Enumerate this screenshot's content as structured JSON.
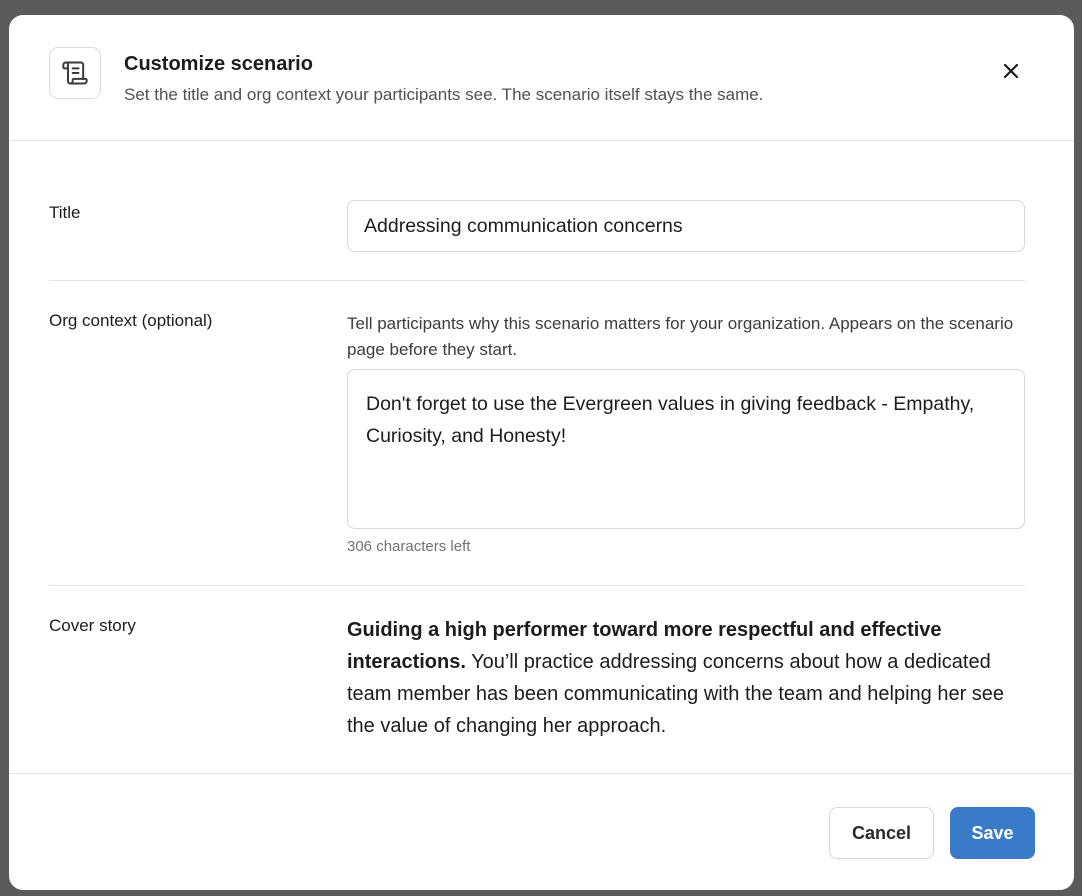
{
  "header": {
    "icon": "scroll-icon",
    "title": "Customize scenario",
    "subtitle": "Set the title and org context your participants see. The scenario itself stays the same.",
    "close_icon": "close-icon"
  },
  "fields": {
    "title": {
      "label": "Title",
      "value": "Addressing communication concerns"
    },
    "org_context": {
      "label": "Org context (optional)",
      "help": "Tell participants why this scenario matters for your organization. Appears on the scenario page before they start.",
      "value": "Don't forget to use the Evergreen values in giving feedback - Empathy, Curiosity, and Honesty!",
      "chars_left": "306 characters left"
    },
    "cover_story": {
      "label": "Cover story",
      "headline": "Guiding a high performer toward more respectful and effective interactions.",
      "body": " You’ll practice addressing concerns about how a dedicated team member has been communicating with the team and helping her see the value of changing her approach."
    }
  },
  "footer": {
    "cancel_label": "Cancel",
    "save_label": "Save"
  },
  "colors": {
    "primary": "#3a7bc8",
    "backdrop": "#5b5b5d"
  }
}
